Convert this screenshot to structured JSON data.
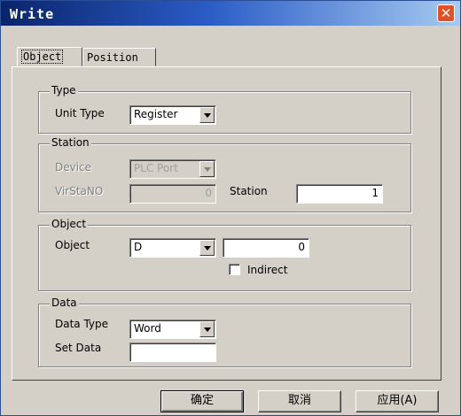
{
  "window": {
    "title": "Write",
    "close_glyph": "✕"
  },
  "tabs": [
    {
      "label": "Object",
      "active": true
    },
    {
      "label": "Position",
      "active": false
    }
  ],
  "groups": {
    "type": {
      "legend": "Type",
      "unit_type_label": "Unit Type",
      "unit_type_value": "Register"
    },
    "station": {
      "legend": "Station",
      "device_label": "Device",
      "device_value": "PLC Port",
      "virstano_label": "VirStaNO",
      "virstano_value": "0",
      "station_label": "Station",
      "station_value": "1"
    },
    "object": {
      "legend": "Object",
      "object_label": "Object",
      "object_type_value": "D",
      "object_addr_value": "0",
      "indirect_label": "Indirect",
      "indirect_checked": false
    },
    "data": {
      "legend": "Data",
      "data_type_label": "Data Type",
      "data_type_value": "Word",
      "set_data_label": "Set Data",
      "set_data_value": ""
    }
  },
  "buttons": {
    "ok": "确定",
    "cancel": "取消",
    "apply": "应用(A)"
  },
  "icons": {
    "dropdown": "chevron-down-icon",
    "close": "close-icon"
  }
}
